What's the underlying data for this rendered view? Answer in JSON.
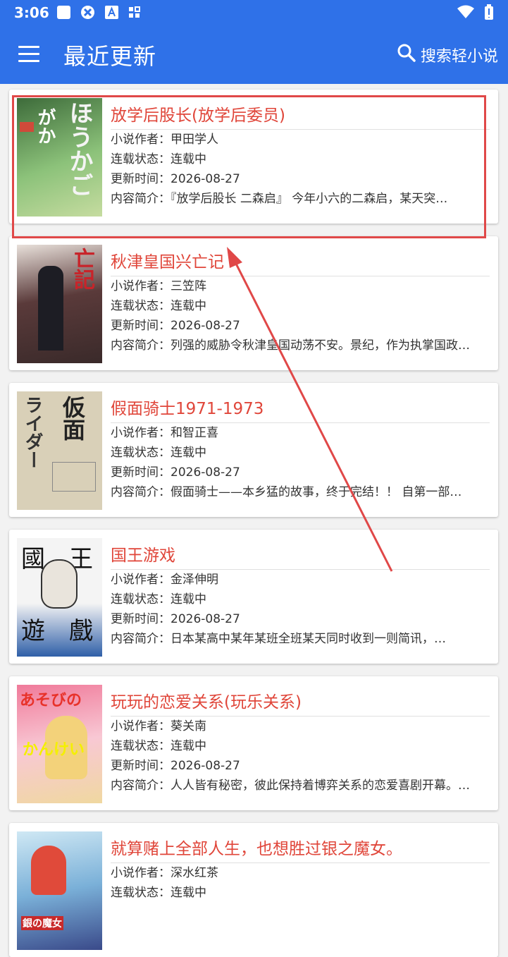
{
  "status_bar": {
    "time": "3:06",
    "icons": [
      "square-icon",
      "app-icon",
      "a-icon",
      "grid-icon",
      "wifi-icon",
      "battery-icon"
    ]
  },
  "app_bar": {
    "title": "最近更新",
    "search_label": "搜索轻小说",
    "background": "#2f71e8"
  },
  "labels": {
    "author": "小说作者：",
    "status": "连载状态：",
    "updated": "更新时间：",
    "summary": "内容简介："
  },
  "books": [
    {
      "title": "放学后股长(放学后委员)",
      "author": "甲田学人",
      "status": "连载中",
      "updated": "2026-08-27",
      "summary": "『放学后股长 二森启』 今年小六的二森启，某天突…",
      "cover_color": "#6c9a52"
    },
    {
      "title": "秋津皇国兴亡记",
      "author": "三笠阵",
      "status": "连载中",
      "updated": "2026-08-27",
      "summary": "列强的威胁令秋津皇国动荡不安。景纪，作为执掌国政…",
      "cover_color": "#8a6a5a"
    },
    {
      "title": "假面骑士1971-1973",
      "author": "和智正喜",
      "status": "连载中",
      "updated": "2026-08-27",
      "summary": "假面骑士——本乡猛的故事，终于完结！！ 自第一部…",
      "cover_color": "#d8cfb6"
    },
    {
      "title": "国王游戏",
      "author": "金泽伸明",
      "status": "连载中",
      "updated": "2026-08-27",
      "summary": "日本某高中某年某班全班某天同时收到一则简讯，…",
      "cover_color": "#2f5fa8"
    },
    {
      "title": "玩玩的恋爱关系(玩乐关系)",
      "author": "葵关南",
      "status": "连载中",
      "updated": "2026-08-27",
      "summary": "人人皆有秘密，彼此保持着博弈关系的恋爱喜剧开幕。…",
      "cover_color": "#f08aa8"
    },
    {
      "title": "就算赌上全部人生，也想胜过银之魔女。",
      "author": "深水红茶",
      "status": "连载中",
      "updated": "",
      "summary": "",
      "cover_color": "#9fd0e8"
    }
  ],
  "annotation": {
    "highlight_color": "#e04848"
  }
}
